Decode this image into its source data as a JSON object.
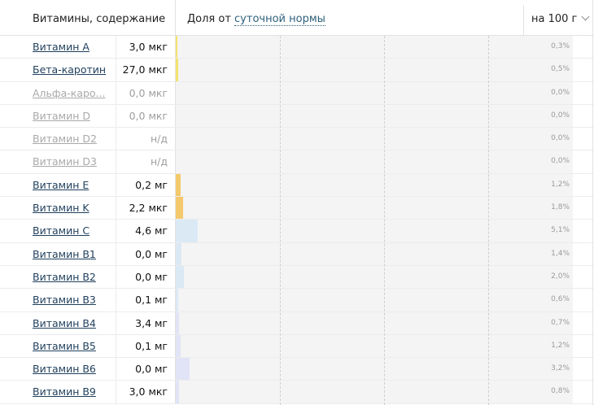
{
  "header": {
    "title": "Витамины, содержание",
    "share_prefix": "Доля от ",
    "share_link": "суточной нормы",
    "per_selector": "на 100 г"
  },
  "rows": [
    {
      "name": "Витамин A",
      "value": "3,0 мкг",
      "percent": "0,3%",
      "bar_pct": 0.3,
      "color": "#f3e36c",
      "dim": false
    },
    {
      "name": "Бета-каротин",
      "value": "27,0 мкг",
      "percent": "0,5%",
      "bar_pct": 0.5,
      "color": "#f3e36c",
      "dim": false
    },
    {
      "name": "Альфа-каро...",
      "value": "0,0 мкг",
      "percent": "0,0%",
      "bar_pct": 0.0,
      "color": "#f3e36c",
      "dim": true
    },
    {
      "name": "Витамин D",
      "value": "0,0 мкг",
      "percent": "0,0%",
      "bar_pct": 0.0,
      "color": "#f3e36c",
      "dim": true
    },
    {
      "name": "Витамин D2",
      "value": "н/д",
      "percent": "0,0%",
      "bar_pct": 0.0,
      "color": "#f3e36c",
      "dim": true
    },
    {
      "name": "Витамин D3",
      "value": "н/д",
      "percent": "0,0%",
      "bar_pct": 0.0,
      "color": "#f3e36c",
      "dim": true
    },
    {
      "name": "Витамин E",
      "value": "0,2 мг",
      "percent": "1,2%",
      "bar_pct": 1.2,
      "color": "#f4c96b",
      "dim": false
    },
    {
      "name": "Витамин K",
      "value": "2,2 мкг",
      "percent": "1,8%",
      "bar_pct": 1.8,
      "color": "#f4c96b",
      "dim": false
    },
    {
      "name": "Витамин C",
      "value": "4,6 мг",
      "percent": "5,1%",
      "bar_pct": 5.1,
      "color": "#dbe9f5",
      "dim": false
    },
    {
      "name": "Витамин B1",
      "value": "0,0 мг",
      "percent": "1,4%",
      "bar_pct": 1.4,
      "color": "#dbe9f5",
      "dim": false
    },
    {
      "name": "Витамин B2",
      "value": "0,0 мг",
      "percent": "2,0%",
      "bar_pct": 2.0,
      "color": "#dbe9f5",
      "dim": false
    },
    {
      "name": "Витамин B3",
      "value": "0,1 мг",
      "percent": "0,6%",
      "bar_pct": 0.6,
      "color": "#dbe9f5",
      "dim": false
    },
    {
      "name": "Витамин B4",
      "value": "3,4 мг",
      "percent": "0,7%",
      "bar_pct": 0.7,
      "color": "#e1e3f6",
      "dim": false
    },
    {
      "name": "Витамин B5",
      "value": "0,1 мг",
      "percent": "1,2%",
      "bar_pct": 1.2,
      "color": "#e1e3f6",
      "dim": false
    },
    {
      "name": "Витамин B6",
      "value": "0,0 мг",
      "percent": "3,2%",
      "bar_pct": 3.2,
      "color": "#e1e3f6",
      "dim": false
    },
    {
      "name": "Витамин B9",
      "value": "3,0 мкг",
      "percent": "0,8%",
      "bar_pct": 0.8,
      "color": "#e1e3f6",
      "dim": false
    }
  ]
}
